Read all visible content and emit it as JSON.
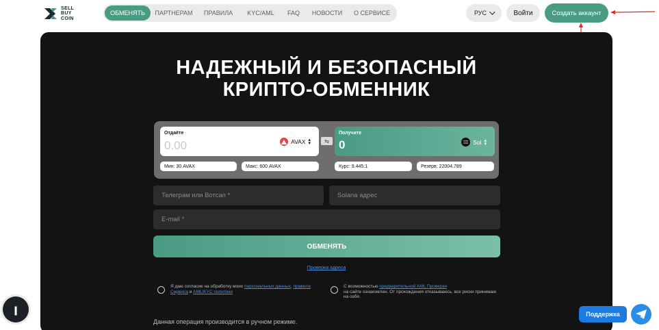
{
  "logo": {
    "line1": "SELL",
    "line2": "BUY",
    "line3": "COIN"
  },
  "nav": [
    {
      "label": "ОБМЕНЯТЬ",
      "active": true
    },
    {
      "label": "ПАРТНЕРАМ"
    },
    {
      "label": "ПРАВИЛА"
    },
    {
      "label": "KYC/AML"
    },
    {
      "label": "FAQ"
    },
    {
      "label": "НОВОСТИ"
    },
    {
      "label": "О СЕРВИСЕ"
    }
  ],
  "header": {
    "lang": "РУС",
    "login": "Войти",
    "signup": "Создать аккаунт"
  },
  "hero": {
    "title_line1": "НАДЕЖНЫЙ И БЕЗОПАСНЫЙ",
    "title_line2": "КРИПТО-ОБМЕННИК"
  },
  "exchange": {
    "give": {
      "label": "Отдаёте",
      "amount": "0.00",
      "currency": "AVAX"
    },
    "receive": {
      "label": "Получите",
      "amount": "0",
      "currency": "Sol"
    },
    "min": "Мин: 30 AVAX",
    "max": "Макс: 600 AVAX",
    "rate": "Курс: 9.445:1",
    "reserve": "Резерв: 22004.789"
  },
  "form": {
    "contact_placeholder": "Телеграм или Вотсап *",
    "address_placeholder": "Solana адрес",
    "email_placeholder": "E-mail *",
    "submit": "ОБМЕНЯТЬ",
    "verify_link": "Проверка адреса"
  },
  "consent": {
    "left_prefix": "Я даю согласие на обработку моих ",
    "left_link1": "персональных данных",
    "left_sep": ",",
    "left_link2": "правила Сервиса",
    "left_and": " и ",
    "left_link3": "AML/KYC политики",
    "right_prefix": "С возможностью ",
    "right_link": "предварительной AML Проверки",
    "right_suffix": "на сайте ознакомлен. От прохождения отказываюсь, все риски принимаю на себя."
  },
  "note": "Данная операция производится в ручном режиме.",
  "support": {
    "label": "Поддержка"
  },
  "colors": {
    "accent": "#4a9b84",
    "dark": "#131313",
    "link": "#4d8fd8",
    "support": "#1f7ae0",
    "annotation": "#e32626"
  },
  "icons": {
    "give_coin": "avax-icon",
    "receive_coin": "solana-icon",
    "swap": "swap-icon",
    "support": "telegram-icon"
  }
}
